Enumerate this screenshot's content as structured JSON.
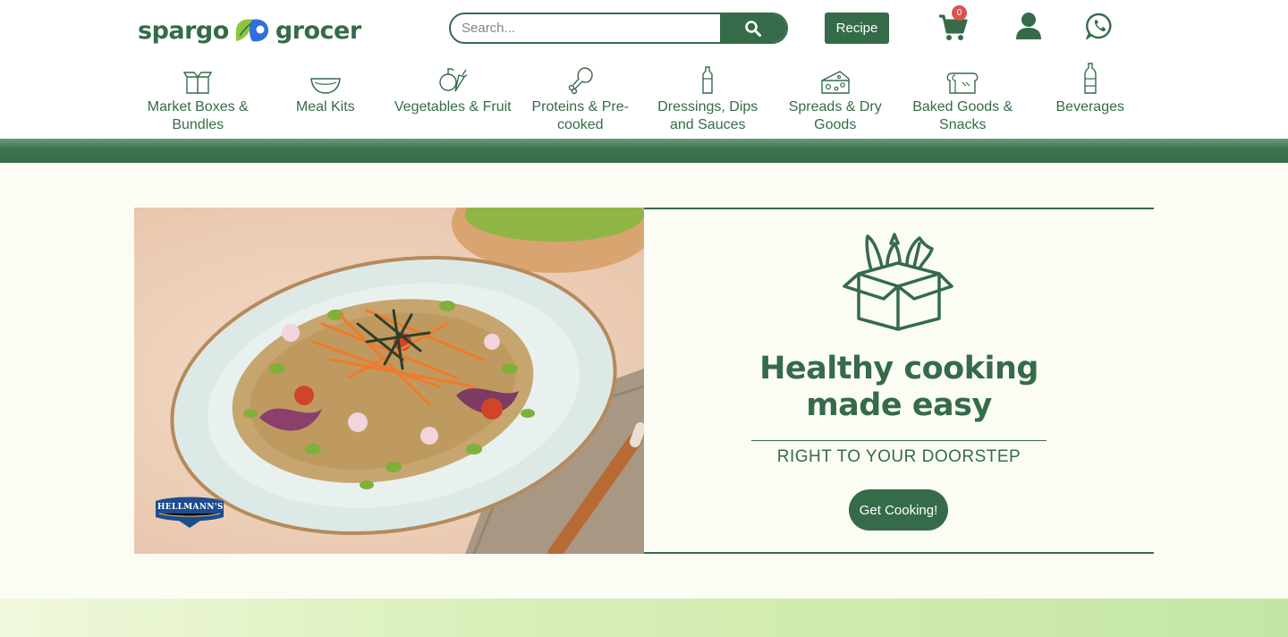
{
  "header": {
    "logo": {
      "word1": "spargo",
      "word2": "grocer"
    },
    "search": {
      "placeholder": "Search..."
    },
    "recipe_label": "Recipe",
    "cart": {
      "count": "0",
      "icon": "cart-icon"
    },
    "user_icon": "user-icon",
    "whatsapp_icon": "whatsapp-icon"
  },
  "nav": {
    "items": [
      {
        "label": "Market Boxes & Bundles",
        "icon": "market-box-icon"
      },
      {
        "label": "Meal Kits",
        "icon": "bowl-icon"
      },
      {
        "label": "Vegetables & Fruit",
        "icon": "vegetables-icon"
      },
      {
        "label": "Proteins & Pre-cooked",
        "icon": "drumstick-icon"
      },
      {
        "label": "Dressings, Dips and Sauces",
        "icon": "sauce-bottle-icon"
      },
      {
        "label": "Spreads & Dry Goods",
        "icon": "cheese-icon"
      },
      {
        "label": "Baked Goods & Snacks",
        "icon": "bread-icon"
      },
      {
        "label": "Beverages",
        "icon": "bottle-icon"
      }
    ]
  },
  "hero": {
    "image_badge": "HELLMANN'S",
    "title_line1": "Healthy cooking",
    "title_line2": "made easy",
    "subtitle": "RIGHT TO YOUR DOORSTEP",
    "button_label": "Get Cooking!",
    "box_icon": "grocery-box-icon"
  },
  "colors": {
    "brand_green": "#356b48",
    "page_bg": "#fbfdf5",
    "badge_red": "#d9534f",
    "logo_blue": "#2f6fe0",
    "logo_leaf": "#8cc63f"
  }
}
